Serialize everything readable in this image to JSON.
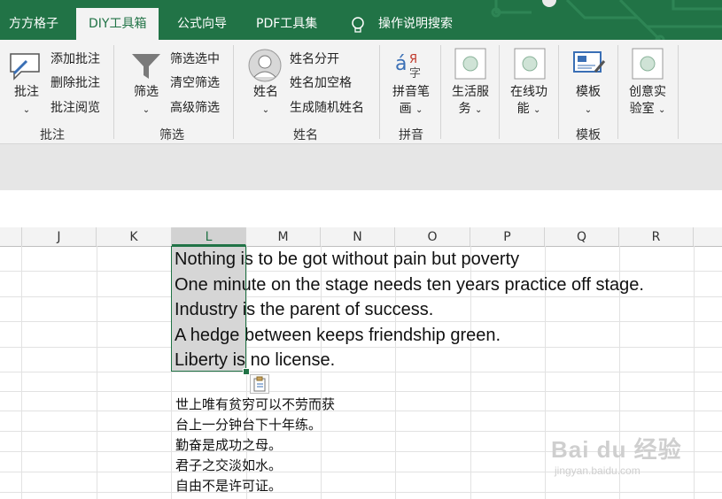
{
  "tabs": [
    "方方格子",
    "DIY工具箱",
    "公式向导",
    "PDF工具集",
    "操作说明搜索"
  ],
  "active_tab": "DIY工具箱",
  "ribbon": {
    "pizhu": {
      "big": "批注",
      "items": [
        "添加批注",
        "删除批注",
        "批注阅览"
      ],
      "label": "批注"
    },
    "shaixuan": {
      "big": "筛选",
      "items": [
        "筛选选中",
        "清空筛选",
        "高级筛选"
      ],
      "label": "筛选"
    },
    "xingming": {
      "big": "姓名",
      "items": [
        "姓名分开",
        "姓名加空格",
        "生成随机姓名"
      ],
      "label": "姓名"
    },
    "pinyin": {
      "big_line1": "拼音笔",
      "big_line2": "画",
      "label": "拼音"
    },
    "shenghuo": {
      "line1": "生活服",
      "line2": "务"
    },
    "zaixian": {
      "line1": "在线功",
      "line2": "能"
    },
    "muban": {
      "big": "模板",
      "label": "模板"
    },
    "chuangyi": {
      "line1": "创意实",
      "line2": "验室"
    }
  },
  "columns": [
    "J",
    "K",
    "L",
    "M",
    "N",
    "O",
    "P",
    "Q",
    "R"
  ],
  "selected_column": "L",
  "english_lines": [
    "Nothing is to be got without pain but poverty",
    "One minute on the stage needs ten years practice off stage.",
    "Industry is the parent of success.",
    "A hedge between keeps friendship green.",
    "Liberty is no license."
  ],
  "chinese_lines": [
    "世上唯有贫穷可以不劳而获",
    "台上一分钟台下十年练。",
    "勤奋是成功之母。",
    "君子之交淡如水。",
    "自由不是许可证。"
  ],
  "watermark": {
    "main": "Bai du 经验",
    "sub": "jingyan.baidu.com"
  },
  "colors": {
    "accent": "#217346",
    "ribbon_bg": "#f3f3f3",
    "selection_fill": "#d6d6d6"
  }
}
